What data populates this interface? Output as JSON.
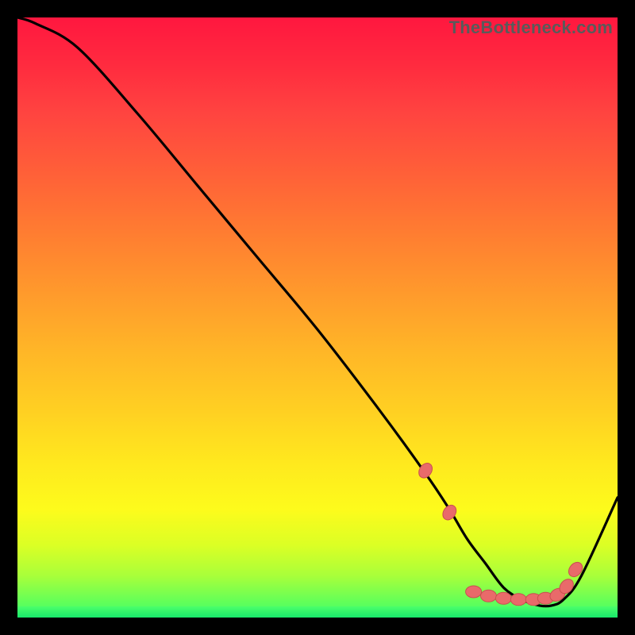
{
  "watermark": "TheBottleneck.com",
  "chart_data": {
    "type": "line",
    "title": "",
    "xlabel": "",
    "ylabel": "",
    "xlim": [
      0,
      100
    ],
    "ylim": [
      0,
      100
    ],
    "series": [
      {
        "name": "bottleneck-curve",
        "x": [
          0,
          3,
          10,
          20,
          30,
          40,
          50,
          60,
          68,
          72,
          75,
          78,
          81,
          84,
          87,
          89,
          91,
          94,
          100
        ],
        "y": [
          100,
          99,
          95,
          84,
          72,
          60,
          48,
          35,
          24,
          18,
          13,
          9,
          5,
          3,
          2,
          2,
          3,
          7,
          20
        ]
      }
    ],
    "markers": {
      "name": "highlight-points",
      "x": [
        68,
        72,
        76,
        78.5,
        81,
        83.5,
        86,
        88,
        90,
        91.5,
        93
      ],
      "y": [
        24.5,
        17.5,
        4.3,
        3.6,
        3.2,
        3.0,
        3.0,
        3.2,
        3.8,
        5.2,
        8.0
      ]
    },
    "colors": {
      "curve": "#000000",
      "marker_fill": "#e96a6a",
      "marker_stroke": "#c94f4f"
    }
  }
}
